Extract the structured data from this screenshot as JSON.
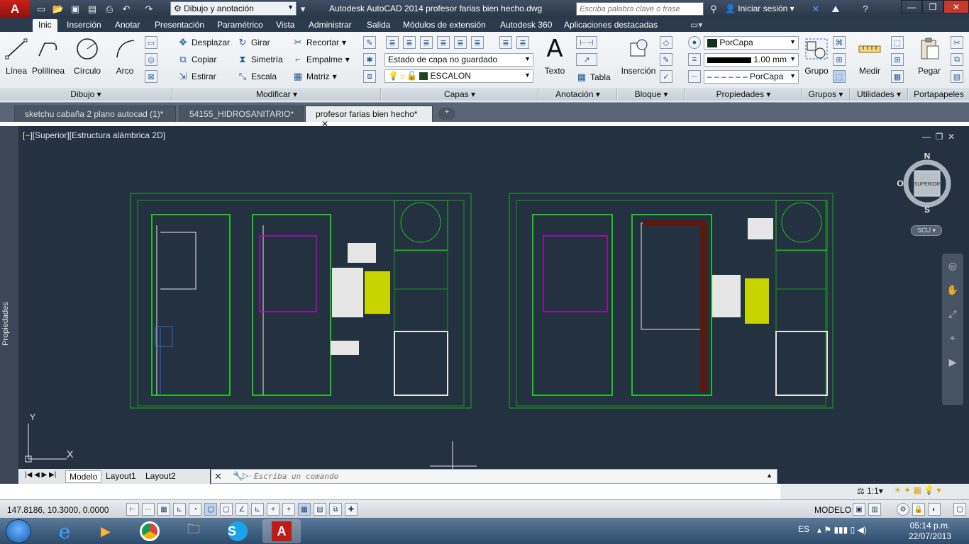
{
  "titlebar": {
    "workspace": "Dibujo y anotación",
    "title": "Autodesk AutoCAD 2014    profesor farias bien hecho.dwg",
    "search_placeholder": "Escriba palabra clave o frase",
    "signin": "Iniciar sesión",
    "app_letter": "A"
  },
  "ribbon_tabs": [
    "Inic",
    "Inserción",
    "Anotar",
    "Presentación",
    "Paramétrico",
    "Vista",
    "Administrar",
    "Salida",
    "Módulos de extensión",
    "Autodesk 360",
    "Aplicaciones destacadas"
  ],
  "panels": {
    "dibujo": {
      "title": "Dibujo",
      "linea": "Línea",
      "polilinea": "Polilínea",
      "circulo": "Círculo",
      "arco": "Arco"
    },
    "modificar": {
      "title": "Modificar",
      "desplazar": "Desplazar",
      "girar": "Girar",
      "recortar": "Recortar",
      "copiar": "Copiar",
      "simetria": "Simetría",
      "empalme": "Empalme",
      "estirar": "Estirar",
      "escala": "Escala",
      "matriz": "Matriz"
    },
    "capas": {
      "title": "Capas",
      "state": "Estado de capa no guardado",
      "layer": "ESCALON"
    },
    "anotacion": {
      "title": "Anotación",
      "texto": "Texto",
      "tabla": "Tabla"
    },
    "bloque": {
      "title": "Bloque",
      "insercion": "Inserción"
    },
    "propiedades": {
      "title": "Propiedades",
      "color": "PorCapa",
      "lineweight": "1.00 mm",
      "linetype": "PorCapa"
    },
    "grupos": {
      "title": "Grupos",
      "grupo": "Grupo"
    },
    "utilidades": {
      "title": "Utilidades",
      "medir": "Medir"
    },
    "portapapeles": {
      "title": "Portapapeles",
      "pegar": "Pegar"
    }
  },
  "doc_tabs": [
    "sketchu cabaña 2 plano autocad (1)*",
    "54155_HIDROSANITARIO*",
    "profesor farias bien hecho*"
  ],
  "viewport": {
    "label": "[−][Superior][Estructura alámbrica 2D]",
    "viewcube_face": "SUPERIOR",
    "north": "N",
    "south": "S",
    "west": "O",
    "wcs": "SCU",
    "axis_y": "Y",
    "axis_x": "X"
  },
  "propstrip": "Propiedades",
  "layout_tabs": [
    "Modelo",
    "Layout1",
    "Layout2"
  ],
  "command": {
    "placeholder": "Escriba un comando"
  },
  "status": {
    "coords": "147.8186, 10.3000, 0.0000",
    "model": "MODELO",
    "scale": "1:1"
  },
  "taskbar": {
    "lang": "ES",
    "time": "05:14 p.m.",
    "date": "22/07/2013"
  }
}
